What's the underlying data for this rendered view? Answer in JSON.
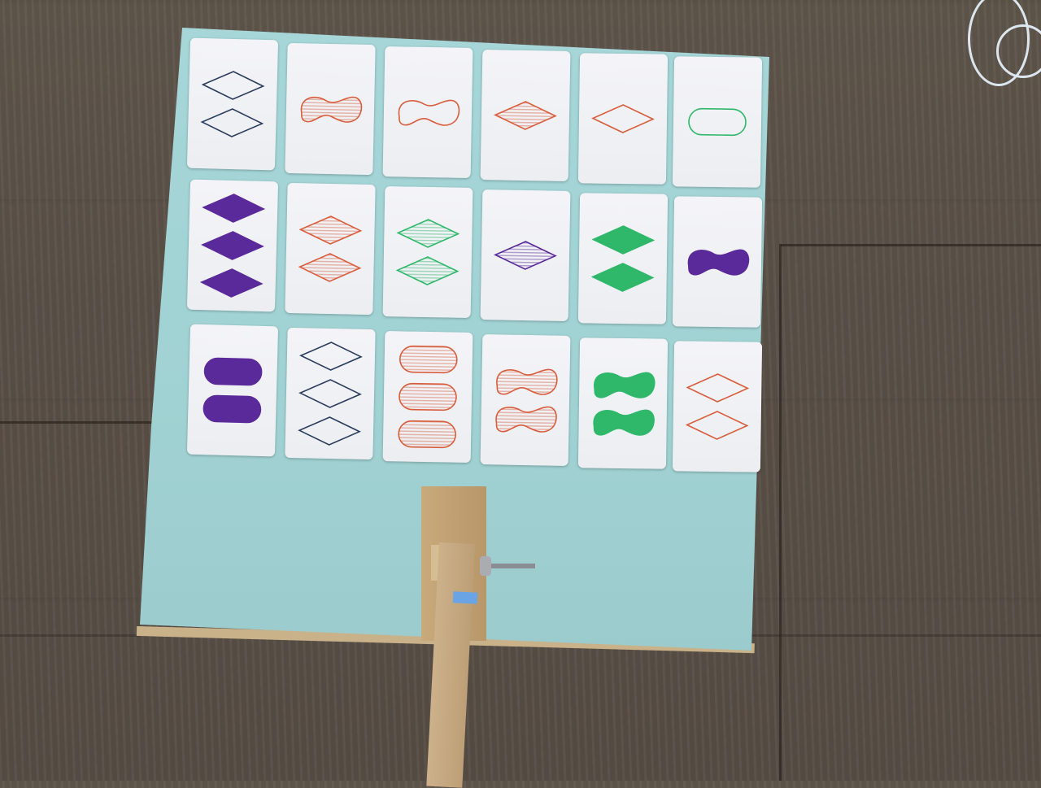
{
  "colors": {
    "red": "#d95d3c",
    "green": "#2fb76a",
    "purple": "#5a2a9a",
    "navy": "#2b3d5c"
  },
  "cards": [
    {
      "row": 0,
      "col": 0,
      "count": 2,
      "shape": "diamond",
      "fill": "empty",
      "color": "navy"
    },
    {
      "row": 0,
      "col": 1,
      "count": 1,
      "shape": "squiggle",
      "fill": "striped",
      "color": "red"
    },
    {
      "row": 0,
      "col": 2,
      "count": 1,
      "shape": "squiggle",
      "fill": "empty",
      "color": "red"
    },
    {
      "row": 0,
      "col": 3,
      "count": 1,
      "shape": "diamond",
      "fill": "striped",
      "color": "red"
    },
    {
      "row": 0,
      "col": 4,
      "count": 1,
      "shape": "diamond",
      "fill": "empty",
      "color": "red"
    },
    {
      "row": 0,
      "col": 5,
      "count": 1,
      "shape": "oval",
      "fill": "empty",
      "color": "green"
    },
    {
      "row": 1,
      "col": 0,
      "count": 3,
      "shape": "diamond",
      "fill": "solid",
      "color": "purple"
    },
    {
      "row": 1,
      "col": 1,
      "count": 2,
      "shape": "diamond",
      "fill": "striped",
      "color": "red"
    },
    {
      "row": 1,
      "col": 2,
      "count": 2,
      "shape": "diamond",
      "fill": "striped",
      "color": "green"
    },
    {
      "row": 1,
      "col": 3,
      "count": 1,
      "shape": "diamond",
      "fill": "striped",
      "color": "purple"
    },
    {
      "row": 1,
      "col": 4,
      "count": 2,
      "shape": "diamond",
      "fill": "solid",
      "color": "green"
    },
    {
      "row": 1,
      "col": 5,
      "count": 1,
      "shape": "squiggle",
      "fill": "solid",
      "color": "purple"
    },
    {
      "row": 2,
      "col": 0,
      "count": 2,
      "shape": "oval",
      "fill": "solid",
      "color": "purple"
    },
    {
      "row": 2,
      "col": 1,
      "count": 3,
      "shape": "diamond",
      "fill": "empty",
      "color": "navy"
    },
    {
      "row": 2,
      "col": 2,
      "count": 3,
      "shape": "oval",
      "fill": "striped",
      "color": "red"
    },
    {
      "row": 2,
      "col": 3,
      "count": 2,
      "shape": "squiggle",
      "fill": "striped",
      "color": "red"
    },
    {
      "row": 2,
      "col": 4,
      "count": 2,
      "shape": "squiggle",
      "fill": "solid",
      "color": "green"
    },
    {
      "row": 2,
      "col": 5,
      "count": 2,
      "shape": "diamond",
      "fill": "empty",
      "color": "red"
    }
  ]
}
